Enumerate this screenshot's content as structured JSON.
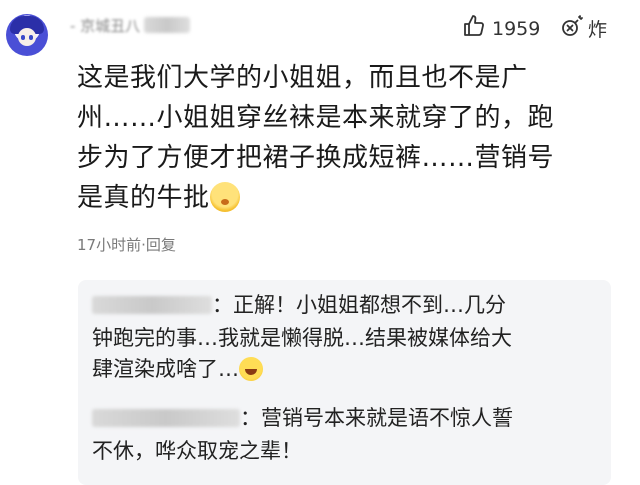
{
  "comment": {
    "username": "- 京城丑八",
    "likes_count": "1959",
    "reply_label": "炸",
    "text_lines": [
      "这是我们大学的小姐姐，而且也不是广",
      "州……小姐姐穿丝袜是本来就穿了的，跑",
      "步为了方便才把裙子换成短裤……营销号",
      "是真的牛批"
    ],
    "timestamp": "17小时前",
    "reply_link": "回复"
  },
  "replies": [
    {
      "username": "",
      "lines": [
        "：正解！小姐姐都想不到…几分",
        "钟跑完的事…我就是懒得脱…结果被媒体给大",
        "肆渲染成啥了…"
      ]
    },
    {
      "username": "",
      "lines": [
        "：营销号本来就是语不惊人誓",
        "不休，哗众取宠之辈！"
      ]
    }
  ],
  "icons": {
    "like": "thumbs-up-icon",
    "reply": "bomb-icon",
    "emoji_main": "blushing-face-emoji",
    "emoji_reply": "laughing-face-emoji"
  }
}
